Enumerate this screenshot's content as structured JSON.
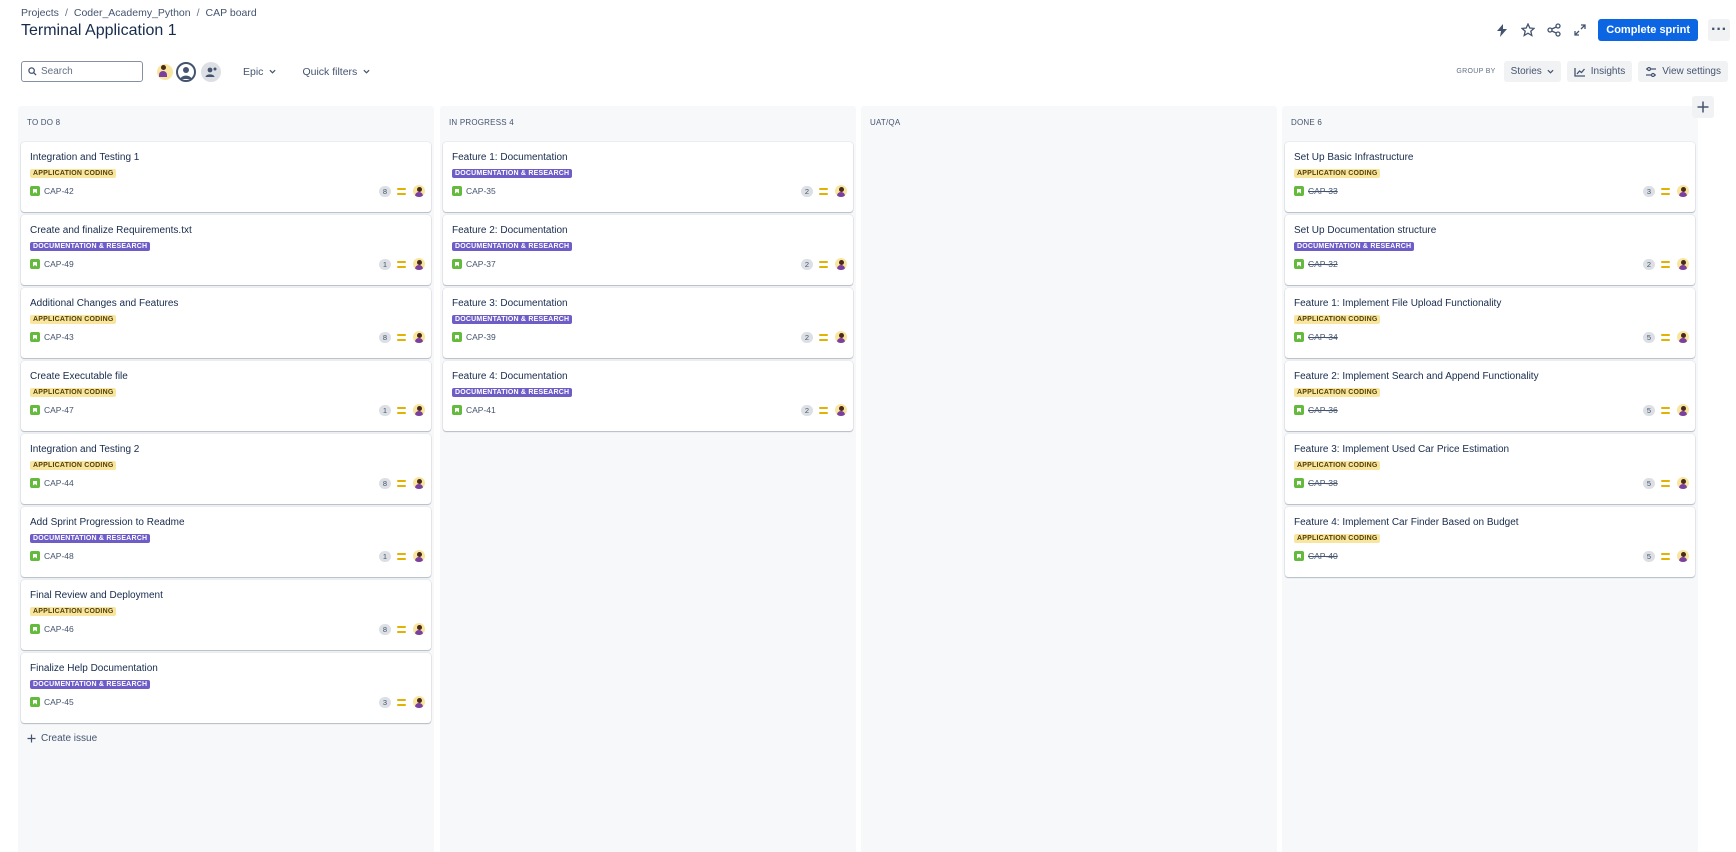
{
  "breadcrumb": [
    "Projects",
    "Coder_Academy_Python",
    "CAP board"
  ],
  "page_title": "Terminal Application 1",
  "header_actions": {
    "complete_sprint": "Complete sprint",
    "more": "···"
  },
  "toolbar": {
    "search_placeholder": "Search",
    "epic_label": "Epic",
    "quick_filters_label": "Quick filters",
    "group_by_label": "GROUP BY",
    "group_by_value": "Stories",
    "insights_label": "Insights",
    "view_settings_label": "View settings"
  },
  "colors": {
    "accent": "#0c66e4",
    "app_coding": "#f8e6a0",
    "doc_research": "#6e5dc6",
    "story": "#63ba3c",
    "priority": "#e2b203"
  },
  "columns": [
    {
      "title": "TO DO 8",
      "create_issue": "Create issue",
      "cards": [
        {
          "title": "Integration and Testing 1",
          "label": "APPLICATION CODING",
          "type": "app",
          "key": "CAP-42",
          "points": "8",
          "done": false
        },
        {
          "title": "Create and finalize Requirements.txt",
          "label": "DOCUMENTATION & RESEARCH",
          "type": "doc",
          "key": "CAP-49",
          "points": "1",
          "done": false
        },
        {
          "title": "Additional Changes and Features",
          "label": "APPLICATION CODING",
          "type": "app",
          "key": "CAP-43",
          "points": "8",
          "done": false
        },
        {
          "title": "Create Executable file",
          "label": "APPLICATION CODING",
          "type": "app",
          "key": "CAP-47",
          "points": "1",
          "done": false
        },
        {
          "title": "Integration and Testing 2",
          "label": "APPLICATION CODING",
          "type": "app",
          "key": "CAP-44",
          "points": "8",
          "done": false
        },
        {
          "title": "Add Sprint Progression to Readme",
          "label": "DOCUMENTATION & RESEARCH",
          "type": "doc",
          "key": "CAP-48",
          "points": "1",
          "done": false
        },
        {
          "title": "Final Review and Deployment",
          "label": "APPLICATION CODING",
          "type": "app",
          "key": "CAP-46",
          "points": "8",
          "done": false
        },
        {
          "title": "Finalize Help Documentation",
          "label": "DOCUMENTATION & RESEARCH",
          "type": "doc",
          "key": "CAP-45",
          "points": "3",
          "done": false
        }
      ]
    },
    {
      "title": "IN PROGRESS 4",
      "cards": [
        {
          "title": "Feature 1: Documentation",
          "label": "DOCUMENTATION & RESEARCH",
          "type": "doc",
          "key": "CAP-35",
          "points": "2",
          "done": false
        },
        {
          "title": "Feature 2: Documentation",
          "label": "DOCUMENTATION & RESEARCH",
          "type": "doc",
          "key": "CAP-37",
          "points": "2",
          "done": false
        },
        {
          "title": "Feature 3: Documentation",
          "label": "DOCUMENTATION & RESEARCH",
          "type": "doc",
          "key": "CAP-39",
          "points": "2",
          "done": false
        },
        {
          "title": "Feature 4: Documentation",
          "label": "DOCUMENTATION & RESEARCH",
          "type": "doc",
          "key": "CAP-41",
          "points": "2",
          "done": false
        }
      ]
    },
    {
      "title": "UAT/QA",
      "cards": []
    },
    {
      "title": "DONE 6",
      "cards": [
        {
          "title": "Set Up Basic Infrastructure",
          "label": "APPLICATION CODING",
          "type": "app",
          "key": "CAP-33",
          "points": "3",
          "done": true
        },
        {
          "title": "Set Up Documentation structure",
          "label": "DOCUMENTATION & RESEARCH",
          "type": "doc",
          "key": "CAP-32",
          "points": "2",
          "done": true
        },
        {
          "title": "Feature 1: Implement File Upload Functionality",
          "label": "APPLICATION CODING",
          "type": "app",
          "key": "CAP-34",
          "points": "5",
          "done": true
        },
        {
          "title": "Feature 2: Implement Search and Append Functionality",
          "label": "APPLICATION CODING",
          "type": "app",
          "key": "CAP-36",
          "points": "5",
          "done": true
        },
        {
          "title": "Feature 3: Implement Used Car Price Estimation",
          "label": "APPLICATION CODING",
          "type": "app",
          "key": "CAP-38",
          "points": "5",
          "done": true
        },
        {
          "title": "Feature 4: Implement Car Finder Based on Budget",
          "label": "APPLICATION CODING",
          "type": "app",
          "key": "CAP-40",
          "points": "5",
          "done": true
        }
      ]
    }
  ]
}
